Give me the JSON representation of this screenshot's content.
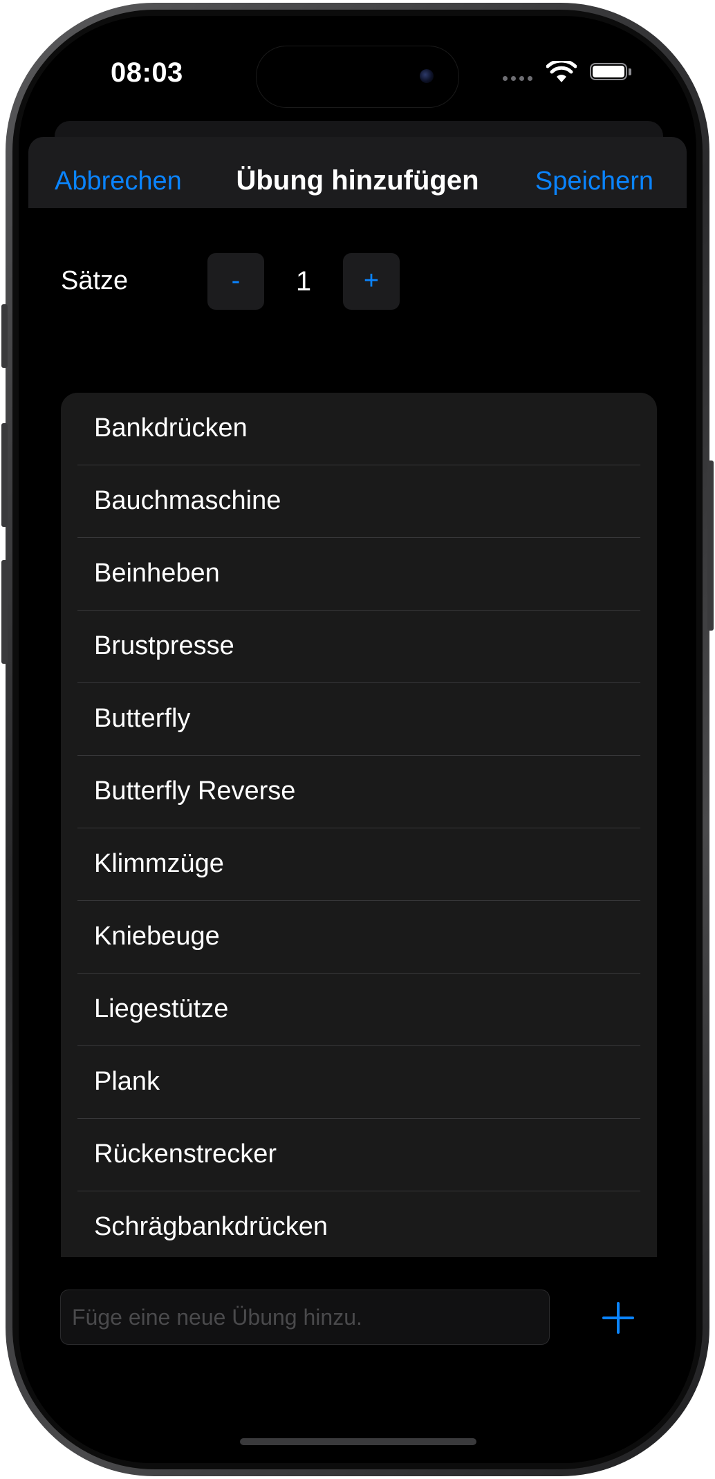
{
  "status_bar": {
    "time": "08:03",
    "signal_icon": "cellular-dots-icon",
    "wifi_icon": "wifi-icon",
    "battery_icon": "battery-icon"
  },
  "nav": {
    "cancel_label": "Abbrechen",
    "title": "Übung hinzufügen",
    "save_label": "Speichern"
  },
  "sets": {
    "label": "Sätze",
    "decrement_label": "-",
    "value": "1",
    "increment_label": "+"
  },
  "exercises": [
    {
      "label": "Bankdrücken"
    },
    {
      "label": "Bauchmaschine"
    },
    {
      "label": "Beinheben"
    },
    {
      "label": "Brustpresse"
    },
    {
      "label": "Butterfly"
    },
    {
      "label": "Butterfly Reverse"
    },
    {
      "label": "Klimmzüge"
    },
    {
      "label": "Kniebeuge"
    },
    {
      "label": "Liegestütze"
    },
    {
      "label": "Plank"
    },
    {
      "label": "Rückenstrecker"
    },
    {
      "label": "Schrägbankdrücken"
    }
  ],
  "new_exercise": {
    "placeholder": "Füge eine neue Übung hinzu.",
    "value": "",
    "add_icon": "plus-icon"
  },
  "colors": {
    "accent": "#0a84ff",
    "background": "#000000",
    "surface": "#1c1c1e",
    "text": "#ffffff"
  }
}
